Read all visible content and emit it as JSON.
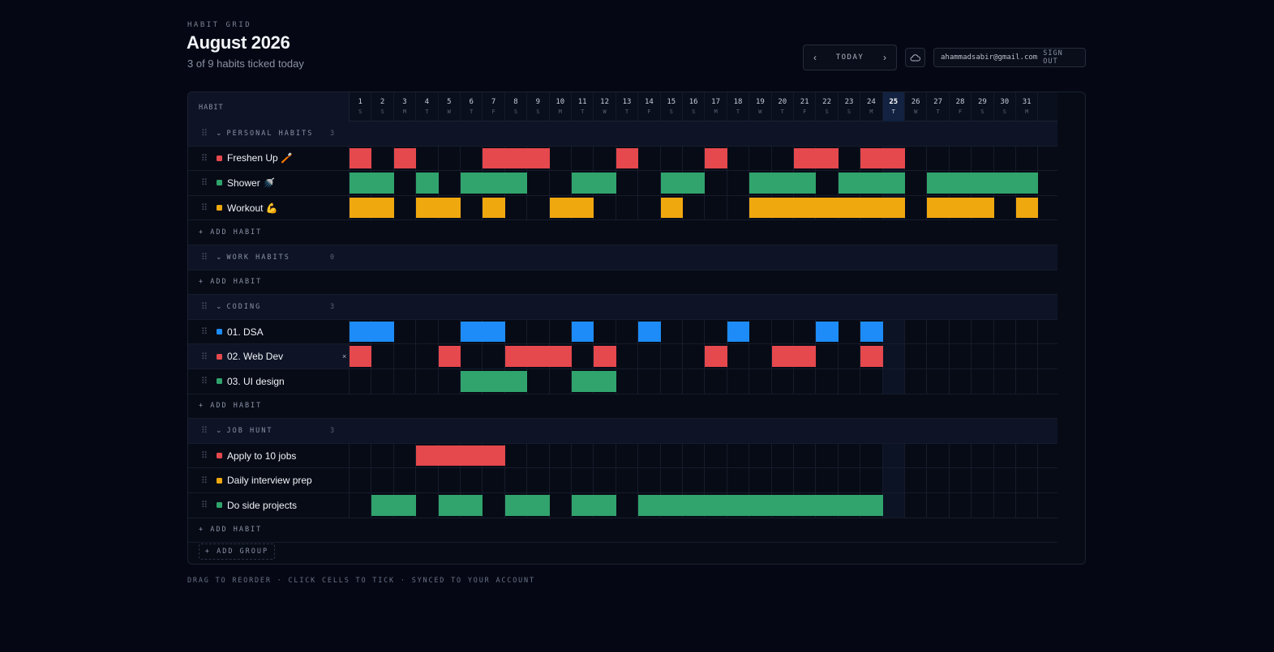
{
  "header": {
    "eyebrow": "HABIT GRID",
    "title": "August 2026",
    "subtitle": "3 of 9 habits ticked today",
    "today_label": "TODAY",
    "email": "ahammadsabir@gmail.com",
    "signout_label": "SIGN OUT"
  },
  "grid": {
    "habit_col_label": "HABIT",
    "today_day": 25,
    "days": [
      {
        "n": "1",
        "w": "S"
      },
      {
        "n": "2",
        "w": "S"
      },
      {
        "n": "3",
        "w": "M"
      },
      {
        "n": "4",
        "w": "T"
      },
      {
        "n": "5",
        "w": "W"
      },
      {
        "n": "6",
        "w": "T"
      },
      {
        "n": "7",
        "w": "F"
      },
      {
        "n": "8",
        "w": "S"
      },
      {
        "n": "9",
        "w": "S"
      },
      {
        "n": "10",
        "w": "M"
      },
      {
        "n": "11",
        "w": "T"
      },
      {
        "n": "12",
        "w": "W"
      },
      {
        "n": "13",
        "w": "T"
      },
      {
        "n": "14",
        "w": "F"
      },
      {
        "n": "15",
        "w": "S"
      },
      {
        "n": "16",
        "w": "S"
      },
      {
        "n": "17",
        "w": "M"
      },
      {
        "n": "18",
        "w": "T"
      },
      {
        "n": "19",
        "w": "W"
      },
      {
        "n": "20",
        "w": "T"
      },
      {
        "n": "21",
        "w": "F"
      },
      {
        "n": "22",
        "w": "S"
      },
      {
        "n": "23",
        "w": "S"
      },
      {
        "n": "24",
        "w": "M"
      },
      {
        "n": "25",
        "w": "T"
      },
      {
        "n": "26",
        "w": "W"
      },
      {
        "n": "27",
        "w": "T"
      },
      {
        "n": "28",
        "w": "F"
      },
      {
        "n": "29",
        "w": "S"
      },
      {
        "n": "30",
        "w": "S"
      },
      {
        "n": "31",
        "w": "M"
      }
    ],
    "add_habit_label": "+ ADD HABIT",
    "add_group_label": "+ ADD GROUP",
    "groups": [
      {
        "name": "PERSONAL HABITS",
        "count": "3",
        "habits": [
          {
            "name": "Freshen Up 🪥",
            "color": "#e5484d",
            "ticks": [
              1,
              3,
              7,
              8,
              9,
              13,
              17,
              21,
              22,
              24,
              25
            ]
          },
          {
            "name": "Shower 🚿",
            "color": "#30a46c",
            "ticks": [
              1,
              2,
              4,
              6,
              7,
              8,
              11,
              12,
              15,
              16,
              19,
              20,
              21,
              23,
              24,
              25,
              27,
              28,
              29,
              30,
              31
            ]
          },
          {
            "name": "Workout 💪",
            "color": "#f0a80f",
            "ticks": [
              1,
              2,
              4,
              5,
              7,
              10,
              11,
              15,
              19,
              20,
              21,
              22,
              23,
              24,
              25,
              27,
              28,
              29,
              31
            ]
          }
        ]
      },
      {
        "name": "WORK HABITS",
        "count": "0",
        "habits": []
      },
      {
        "name": "CODING",
        "count": "3",
        "habits": [
          {
            "name": "01. DSA",
            "color": "#1d8cf8",
            "ticks": [
              1,
              2,
              6,
              7,
              11,
              14,
              18,
              22,
              24
            ]
          },
          {
            "name": "02. Web Dev",
            "color": "#e5484d",
            "ticks": [
              1,
              5,
              8,
              9,
              10,
              12,
              17,
              20,
              21,
              24
            ],
            "hover": true
          },
          {
            "name": "03. UI design",
            "color": "#30a46c",
            "ticks": [
              6,
              7,
              8,
              11,
              12
            ]
          }
        ]
      },
      {
        "name": "JOB HUNT",
        "count": "3",
        "habits": [
          {
            "name": "Apply to 10 jobs",
            "color": "#e5484d",
            "ticks": [
              4,
              5,
              6,
              7
            ]
          },
          {
            "name": "Daily interview prep",
            "color": "#f0a80f",
            "ticks": []
          },
          {
            "name": "Do side projects",
            "color": "#30a46c",
            "ticks": [
              2,
              3,
              5,
              6,
              8,
              9,
              11,
              12,
              14,
              15,
              16,
              17,
              18,
              19,
              20,
              21,
              22,
              23,
              24
            ]
          }
        ]
      }
    ]
  },
  "footer": {
    "text": "DRAG TO REORDER · CLICK CELLS TO TICK · SYNCED TO YOUR ACCOUNT"
  }
}
